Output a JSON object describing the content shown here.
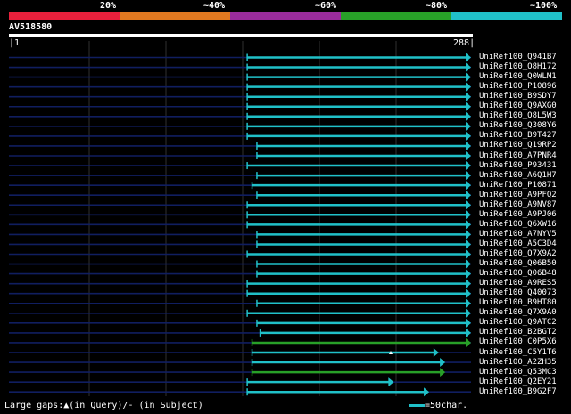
{
  "legend": {
    "labels": [
      "20%",
      "~40%",
      "~60%",
      "~80%",
      "~100%"
    ],
    "colors": [
      "#e8203c",
      "#e07820",
      "#9a2c9c",
      "#28a028",
      "#20c0c8"
    ]
  },
  "query": {
    "name": "AV518580",
    "start": "1",
    "end": "288"
  },
  "colors": {
    "cyan": "#20c0c8",
    "green": "#28a028",
    "navy": "#101e60",
    "grid": "#303030"
  },
  "hits": [
    {
      "name": "UniRef100_Q941B7",
      "start": 149,
      "end": 288,
      "color": "cyan"
    },
    {
      "name": "UniRef100_Q8H172",
      "start": 149,
      "end": 288,
      "color": "cyan"
    },
    {
      "name": "UniRef100_Q0WLM1",
      "start": 149,
      "end": 288,
      "color": "cyan"
    },
    {
      "name": "UniRef100_P10896",
      "start": 149,
      "end": 288,
      "color": "cyan"
    },
    {
      "name": "UniRef100_B9SDY7",
      "start": 149,
      "end": 288,
      "color": "cyan"
    },
    {
      "name": "UniRef100_Q9AXG0",
      "start": 149,
      "end": 288,
      "color": "cyan"
    },
    {
      "name": "UniRef100_Q8L5W3",
      "start": 149,
      "end": 288,
      "color": "cyan"
    },
    {
      "name": "UniRef100_Q308Y6",
      "start": 149,
      "end": 288,
      "color": "cyan"
    },
    {
      "name": "UniRef100_B9T427",
      "start": 149,
      "end": 288,
      "color": "cyan"
    },
    {
      "name": "UniRef100_Q19RP2",
      "start": 155,
      "end": 288,
      "color": "cyan"
    },
    {
      "name": "UniRef100_A7PNR4",
      "start": 155,
      "end": 288,
      "color": "cyan"
    },
    {
      "name": "UniRef100_P93431",
      "start": 149,
      "end": 288,
      "color": "cyan"
    },
    {
      "name": "UniRef100_A6Q1H7",
      "start": 155,
      "end": 288,
      "color": "cyan"
    },
    {
      "name": "UniRef100_P10871",
      "start": 152,
      "end": 288,
      "color": "cyan"
    },
    {
      "name": "UniRef100_A9PFQ2",
      "start": 155,
      "end": 288,
      "color": "cyan"
    },
    {
      "name": "UniRef100_A9NV87",
      "start": 149,
      "end": 288,
      "color": "cyan"
    },
    {
      "name": "UniRef100_A9PJ06",
      "start": 149,
      "end": 288,
      "color": "cyan"
    },
    {
      "name": "UniRef100_Q6XW16",
      "start": 149,
      "end": 288,
      "color": "cyan"
    },
    {
      "name": "UniRef100_A7NYV5",
      "start": 155,
      "end": 288,
      "color": "cyan"
    },
    {
      "name": "UniRef100_A5C3D4",
      "start": 155,
      "end": 288,
      "color": "cyan"
    },
    {
      "name": "UniRef100_Q7X9A2",
      "start": 149,
      "end": 288,
      "color": "cyan"
    },
    {
      "name": "UniRef100_Q06B50",
      "start": 155,
      "end": 288,
      "color": "cyan"
    },
    {
      "name": "UniRef100_Q06B48",
      "start": 155,
      "end": 288,
      "color": "cyan"
    },
    {
      "name": "UniRef100_A9RES5",
      "start": 149,
      "end": 288,
      "color": "cyan"
    },
    {
      "name": "UniRef100_Q40073",
      "start": 149,
      "end": 288,
      "color": "cyan"
    },
    {
      "name": "UniRef100_B9HT80",
      "start": 155,
      "end": 288,
      "color": "cyan"
    },
    {
      "name": "UniRef100_Q7X9A0",
      "start": 149,
      "end": 288,
      "color": "cyan"
    },
    {
      "name": "UniRef100_Q9ATC2",
      "start": 155,
      "end": 288,
      "color": "cyan"
    },
    {
      "name": "UniRef100_B2BGT2",
      "start": 157,
      "end": 288,
      "color": "cyan"
    },
    {
      "name": "UniRef100_C0P5X6",
      "start": 152,
      "end": 288,
      "color": "green"
    },
    {
      "name": "UniRef100_C5Y1T6",
      "start": 152,
      "end": 268,
      "color": "cyan"
    },
    {
      "name": "UniRef100_A2ZH35",
      "start": 152,
      "end": 272,
      "color": "cyan"
    },
    {
      "name": "UniRef100_Q53MC3",
      "start": 152,
      "end": 272,
      "color": "green"
    },
    {
      "name": "UniRef100_Q2EY21",
      "start": 149,
      "end": 240,
      "color": "cyan"
    },
    {
      "name": "UniRef100_B9G2F7",
      "start": 149,
      "end": 262,
      "color": "cyan"
    }
  ],
  "footer": {
    "gaps_text": "Large gaps:▲(in Query)/- (in Subject)",
    "scale_text": "=50char."
  }
}
